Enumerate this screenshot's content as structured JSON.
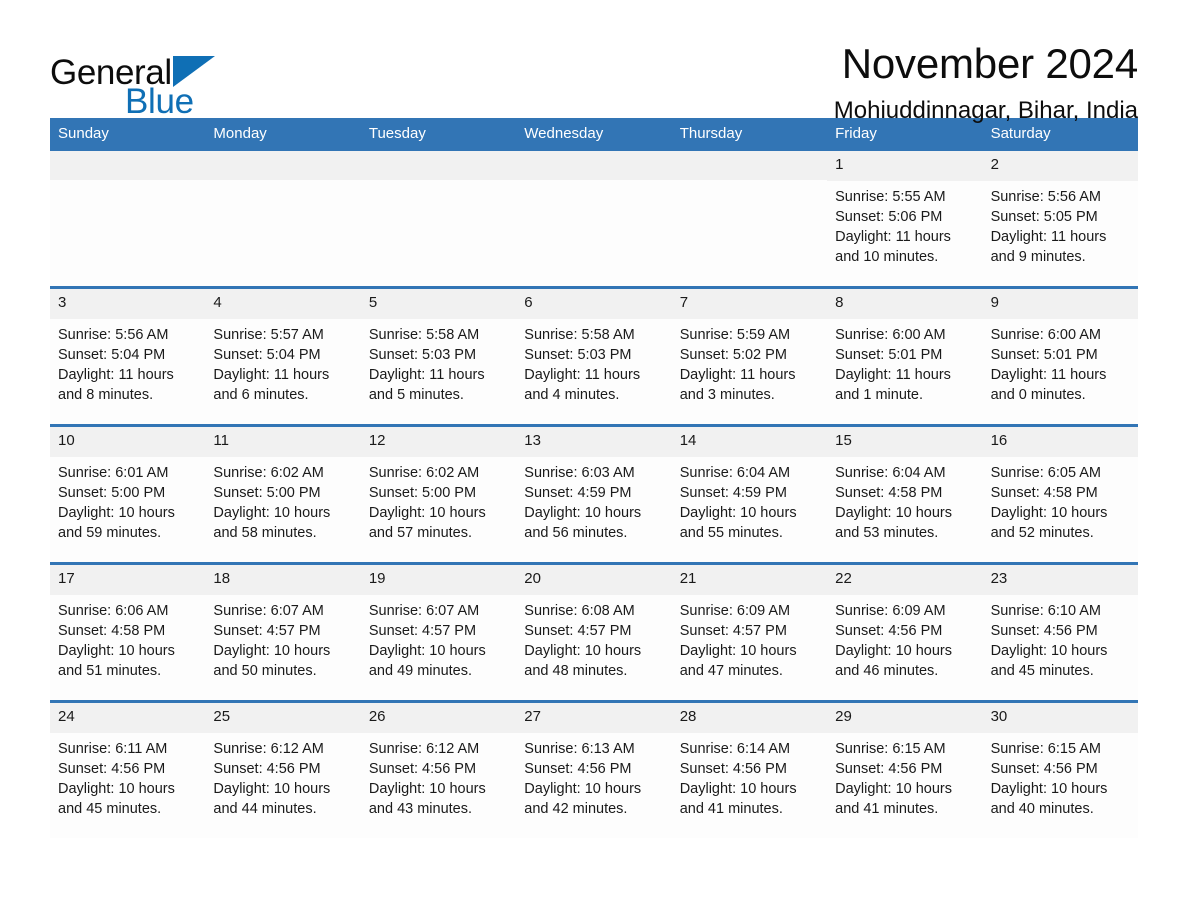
{
  "brand": {
    "name_part1": "General",
    "name_part2": "Blue",
    "triangle_icon": "triangle-logo-icon",
    "accent_color": "#0f6fb5"
  },
  "header": {
    "month_title": "November 2024",
    "location": "Mohiuddinnagar, Bihar, India"
  },
  "calendar": {
    "header_color": "#3275b5",
    "daynum_band_color": "#f1f1f1",
    "weekdays": [
      "Sunday",
      "Monday",
      "Tuesday",
      "Wednesday",
      "Thursday",
      "Friday",
      "Saturday"
    ],
    "weeks": [
      [
        {
          "day": "",
          "empty": true
        },
        {
          "day": "",
          "empty": true
        },
        {
          "day": "",
          "empty": true
        },
        {
          "day": "",
          "empty": true
        },
        {
          "day": "",
          "empty": true
        },
        {
          "day": "1",
          "sunrise": "Sunrise: 5:55 AM",
          "sunset": "Sunset: 5:06 PM",
          "daylight": "Daylight: 11 hours and 10 minutes."
        },
        {
          "day": "2",
          "sunrise": "Sunrise: 5:56 AM",
          "sunset": "Sunset: 5:05 PM",
          "daylight": "Daylight: 11 hours and 9 minutes."
        }
      ],
      [
        {
          "day": "3",
          "sunrise": "Sunrise: 5:56 AM",
          "sunset": "Sunset: 5:04 PM",
          "daylight": "Daylight: 11 hours and 8 minutes."
        },
        {
          "day": "4",
          "sunrise": "Sunrise: 5:57 AM",
          "sunset": "Sunset: 5:04 PM",
          "daylight": "Daylight: 11 hours and 6 minutes."
        },
        {
          "day": "5",
          "sunrise": "Sunrise: 5:58 AM",
          "sunset": "Sunset: 5:03 PM",
          "daylight": "Daylight: 11 hours and 5 minutes."
        },
        {
          "day": "6",
          "sunrise": "Sunrise: 5:58 AM",
          "sunset": "Sunset: 5:03 PM",
          "daylight": "Daylight: 11 hours and 4 minutes."
        },
        {
          "day": "7",
          "sunrise": "Sunrise: 5:59 AM",
          "sunset": "Sunset: 5:02 PM",
          "daylight": "Daylight: 11 hours and 3 minutes."
        },
        {
          "day": "8",
          "sunrise": "Sunrise: 6:00 AM",
          "sunset": "Sunset: 5:01 PM",
          "daylight": "Daylight: 11 hours and 1 minute."
        },
        {
          "day": "9",
          "sunrise": "Sunrise: 6:00 AM",
          "sunset": "Sunset: 5:01 PM",
          "daylight": "Daylight: 11 hours and 0 minutes."
        }
      ],
      [
        {
          "day": "10",
          "sunrise": "Sunrise: 6:01 AM",
          "sunset": "Sunset: 5:00 PM",
          "daylight": "Daylight: 10 hours and 59 minutes."
        },
        {
          "day": "11",
          "sunrise": "Sunrise: 6:02 AM",
          "sunset": "Sunset: 5:00 PM",
          "daylight": "Daylight: 10 hours and 58 minutes."
        },
        {
          "day": "12",
          "sunrise": "Sunrise: 6:02 AM",
          "sunset": "Sunset: 5:00 PM",
          "daylight": "Daylight: 10 hours and 57 minutes."
        },
        {
          "day": "13",
          "sunrise": "Sunrise: 6:03 AM",
          "sunset": "Sunset: 4:59 PM",
          "daylight": "Daylight: 10 hours and 56 minutes."
        },
        {
          "day": "14",
          "sunrise": "Sunrise: 6:04 AM",
          "sunset": "Sunset: 4:59 PM",
          "daylight": "Daylight: 10 hours and 55 minutes."
        },
        {
          "day": "15",
          "sunrise": "Sunrise: 6:04 AM",
          "sunset": "Sunset: 4:58 PM",
          "daylight": "Daylight: 10 hours and 53 minutes."
        },
        {
          "day": "16",
          "sunrise": "Sunrise: 6:05 AM",
          "sunset": "Sunset: 4:58 PM",
          "daylight": "Daylight: 10 hours and 52 minutes."
        }
      ],
      [
        {
          "day": "17",
          "sunrise": "Sunrise: 6:06 AM",
          "sunset": "Sunset: 4:58 PM",
          "daylight": "Daylight: 10 hours and 51 minutes."
        },
        {
          "day": "18",
          "sunrise": "Sunrise: 6:07 AM",
          "sunset": "Sunset: 4:57 PM",
          "daylight": "Daylight: 10 hours and 50 minutes."
        },
        {
          "day": "19",
          "sunrise": "Sunrise: 6:07 AM",
          "sunset": "Sunset: 4:57 PM",
          "daylight": "Daylight: 10 hours and 49 minutes."
        },
        {
          "day": "20",
          "sunrise": "Sunrise: 6:08 AM",
          "sunset": "Sunset: 4:57 PM",
          "daylight": "Daylight: 10 hours and 48 minutes."
        },
        {
          "day": "21",
          "sunrise": "Sunrise: 6:09 AM",
          "sunset": "Sunset: 4:57 PM",
          "daylight": "Daylight: 10 hours and 47 minutes."
        },
        {
          "day": "22",
          "sunrise": "Sunrise: 6:09 AM",
          "sunset": "Sunset: 4:56 PM",
          "daylight": "Daylight: 10 hours and 46 minutes."
        },
        {
          "day": "23",
          "sunrise": "Sunrise: 6:10 AM",
          "sunset": "Sunset: 4:56 PM",
          "daylight": "Daylight: 10 hours and 45 minutes."
        }
      ],
      [
        {
          "day": "24",
          "sunrise": "Sunrise: 6:11 AM",
          "sunset": "Sunset: 4:56 PM",
          "daylight": "Daylight: 10 hours and 45 minutes."
        },
        {
          "day": "25",
          "sunrise": "Sunrise: 6:12 AM",
          "sunset": "Sunset: 4:56 PM",
          "daylight": "Daylight: 10 hours and 44 minutes."
        },
        {
          "day": "26",
          "sunrise": "Sunrise: 6:12 AM",
          "sunset": "Sunset: 4:56 PM",
          "daylight": "Daylight: 10 hours and 43 minutes."
        },
        {
          "day": "27",
          "sunrise": "Sunrise: 6:13 AM",
          "sunset": "Sunset: 4:56 PM",
          "daylight": "Daylight: 10 hours and 42 minutes."
        },
        {
          "day": "28",
          "sunrise": "Sunrise: 6:14 AM",
          "sunset": "Sunset: 4:56 PM",
          "daylight": "Daylight: 10 hours and 41 minutes."
        },
        {
          "day": "29",
          "sunrise": "Sunrise: 6:15 AM",
          "sunset": "Sunset: 4:56 PM",
          "daylight": "Daylight: 10 hours and 41 minutes."
        },
        {
          "day": "30",
          "sunrise": "Sunrise: 6:15 AM",
          "sunset": "Sunset: 4:56 PM",
          "daylight": "Daylight: 10 hours and 40 minutes."
        }
      ]
    ]
  }
}
